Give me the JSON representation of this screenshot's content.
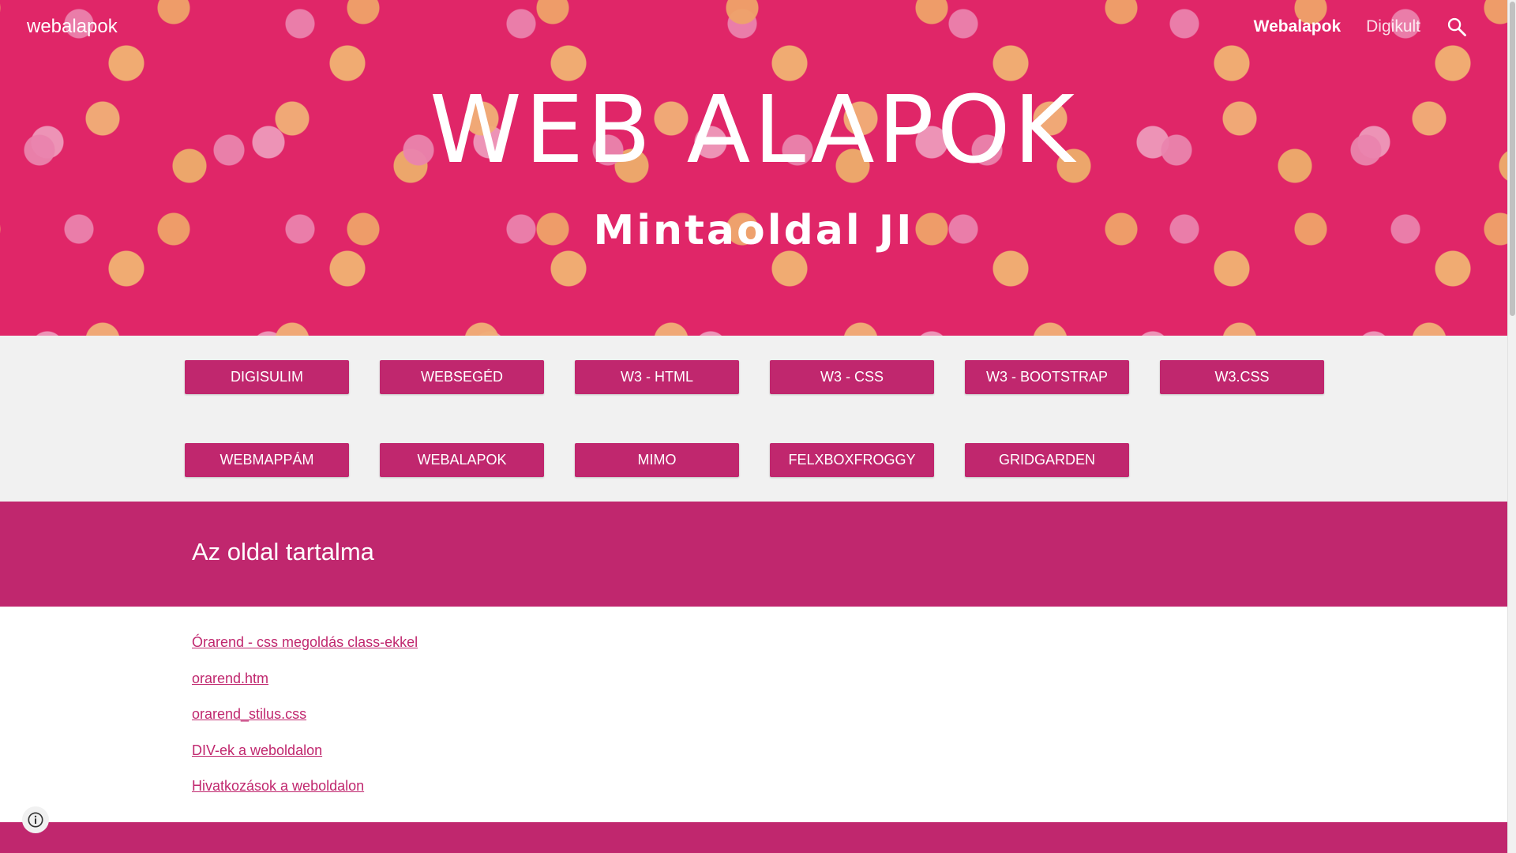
{
  "site": {
    "name": "webalapok"
  },
  "topnav": {
    "items": [
      {
        "label": "Webalapok",
        "active": true
      },
      {
        "label": "Digikult",
        "active": false
      }
    ],
    "search_icon": "search-icon"
  },
  "hero": {
    "title": "WEB ALAPOK",
    "subtitle": "Mintaoldal JI",
    "background_color": "#e4296b"
  },
  "buttons": {
    "row1": [
      "DIGISULIM",
      "WEBSEGÉD",
      "W3 - HTML",
      "W3 - CSS",
      "W3 - BOOTSTRAP",
      "W3.CSS"
    ],
    "row2": [
      "WEBMAPPÁM",
      "WEBALAPOK",
      "MIMO",
      "FELXBOXFROGGY",
      "GRIDGARDEN"
    ],
    "color": "#c0276e"
  },
  "section": {
    "heading": "Az oldal tartalma"
  },
  "links": [
    "Órarend - css megoldás class-ekkel",
    "orarend.htm",
    "orarend_stilus.css",
    "DIV-ek a weboldalon",
    "Hivatkozások a weboldalon"
  ],
  "footer": {
    "info_icon": "info-icon"
  }
}
